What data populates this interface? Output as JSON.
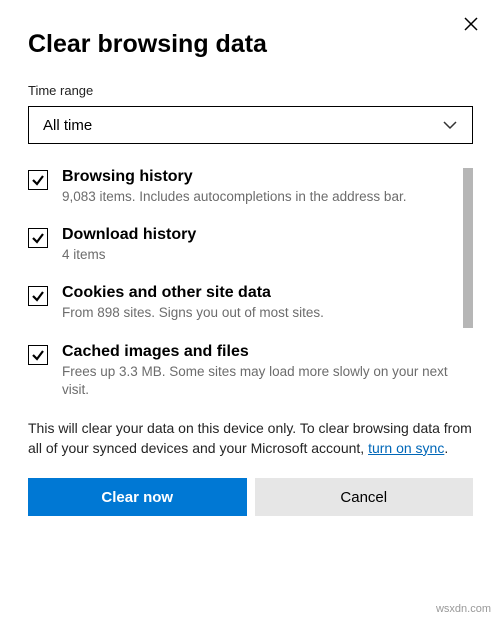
{
  "title": "Clear browsing data",
  "time_range": {
    "label": "Time range",
    "value": "All time"
  },
  "items": [
    {
      "title": "Browsing history",
      "desc": "9,083 items. Includes autocompletions in the address bar."
    },
    {
      "title": "Download history",
      "desc": "4 items"
    },
    {
      "title": "Cookies and other site data",
      "desc": "From 898 sites. Signs you out of most sites."
    },
    {
      "title": "Cached images and files",
      "desc": "Frees up 3.3 MB. Some sites may load more slowly on your next visit."
    }
  ],
  "footer": {
    "text_before": "This will clear your data on this device only. To clear browsing data from all of your synced devices and your Microsoft account, ",
    "link": "turn on sync",
    "text_after": "."
  },
  "buttons": {
    "primary": "Clear now",
    "secondary": "Cancel"
  },
  "watermark": "wsxdn.com"
}
